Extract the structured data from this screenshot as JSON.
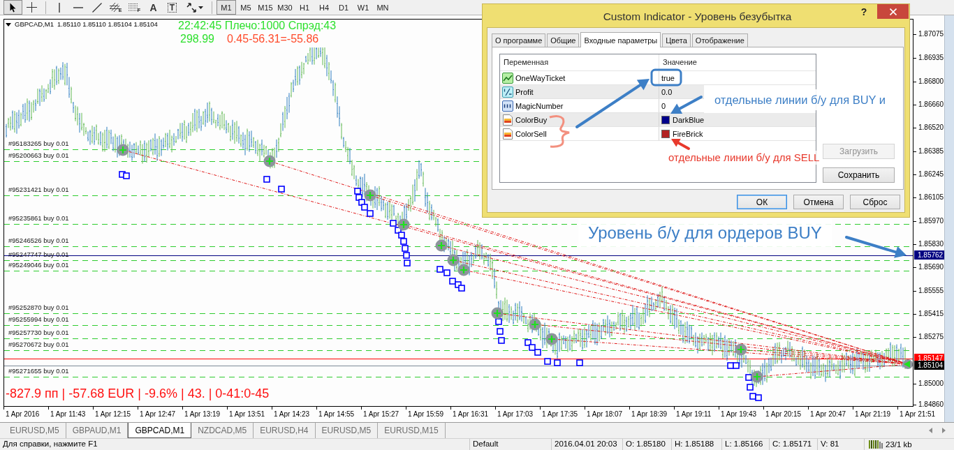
{
  "toolbar": {
    "tools": [
      {
        "kind": "cursor",
        "selected": true
      },
      {
        "kind": "crosshair",
        "selected": false
      },
      {
        "kind": "vertical-line",
        "selected": false
      },
      {
        "kind": "horizontal-line",
        "selected": false
      },
      {
        "kind": "trend-line",
        "selected": false
      },
      {
        "kind": "fibo-channel",
        "letter": "E",
        "selected": false
      },
      {
        "kind": "fibo-lines",
        "letter": "F",
        "selected": false
      },
      {
        "kind": "text",
        "label": "A",
        "selected": false
      },
      {
        "kind": "text-label",
        "label": "T",
        "selected": false
      },
      {
        "kind": "arrows",
        "selected": false
      }
    ],
    "timeframes": [
      {
        "label": "M1",
        "selected": true
      },
      {
        "label": "M5",
        "selected": false
      },
      {
        "label": "M15",
        "selected": false
      },
      {
        "label": "M30",
        "selected": false
      },
      {
        "label": "H1",
        "selected": false
      },
      {
        "label": "H4",
        "selected": false
      },
      {
        "label": "D1",
        "selected": false
      },
      {
        "label": "W1",
        "selected": false
      },
      {
        "label": "MN",
        "selected": false
      }
    ]
  },
  "chart": {
    "symbol": "GBPCAD,M1",
    "quote": "1.85110 1.85110 1.85104 1.85104",
    "status_line": "22:42:45 Плечо:1000 Спрэд:43",
    "balance": "298.99",
    "profit_calc": "0.45-56.31=-55.86",
    "summary": "-827.9 пп | -57.68 EUR | -9.6% | 43. | 0-41:0-45",
    "orders": [
      {
        "label": "#95183265 buy 0.01"
      },
      {
        "label": "#95200663 buy 0.01"
      },
      {
        "label": "#95231421 buy 0.01"
      },
      {
        "label": "#95235861 buy 0.01"
      },
      {
        "label": "#95246526 buy 0.01"
      },
      {
        "label": "#95247747 buy 0.01"
      },
      {
        "label": "#95249046 buy 0.01"
      },
      {
        "label": "#95252870 buy 0.01"
      },
      {
        "label": "#95255994 buy 0.01"
      },
      {
        "label": "#95257730 buy 0.01"
      },
      {
        "label": "#95270672 buy 0.01"
      },
      {
        "label": "#95271655 buy 0.01"
      }
    ],
    "price_ticks": [
      "1.87075",
      "1.86935",
      "1.86800",
      "1.86660",
      "1.86520",
      "1.86385",
      "1.86245",
      "1.86105",
      "1.85970",
      "1.85830",
      "1.85690",
      "1.85555",
      "1.85415",
      "1.85275",
      "1.85000",
      "1.84860"
    ],
    "price_markers": [
      {
        "kind": "breakeven",
        "label": "1.85762",
        "color": "#000080"
      },
      {
        "kind": "ask",
        "label": "1.85147",
        "color": "#ff0000"
      },
      {
        "kind": "bid",
        "label": "1.85104",
        "color": "#000000"
      }
    ],
    "time_ticks": [
      "1 Apr 2016",
      "1 Apr 11:43",
      "1 Apr 12:15",
      "1 Apr 12:47",
      "1 Apr 13:19",
      "1 Apr 13:51",
      "1 Apr 14:23",
      "1 Apr 14:55",
      "1 Apr 15:27",
      "1 Apr 15:59",
      "1 Apr 16:31",
      "1 Apr 17:03",
      "1 Apr 17:35",
      "1 Apr 18:07",
      "1 Apr 18:39",
      "1 Apr 19:11",
      "1 Apr 19:43",
      "1 Apr 20:15",
      "1 Apr 20:47",
      "1 Apr 21:19",
      "1 Apr 21:51"
    ]
  },
  "dialog": {
    "title": "Custom Indicator - Уровень безубытка",
    "help": "?",
    "tabs": [
      {
        "label": "О программе",
        "selected": false
      },
      {
        "label": "Общие",
        "selected": false
      },
      {
        "label": "Входные параметры",
        "selected": true
      },
      {
        "label": "Цвета",
        "selected": false
      },
      {
        "label": "Отображение",
        "selected": false
      }
    ],
    "columns": [
      "Переменная",
      "Значение"
    ],
    "parameters": [
      {
        "kind": "bool",
        "name": "OneWayTicket",
        "value": "true"
      },
      {
        "kind": "double",
        "name": "Profit",
        "value": "0.0"
      },
      {
        "kind": "int",
        "name": "MagicNumber",
        "value": "0"
      },
      {
        "kind": "color",
        "name": "ColorBuy",
        "value": "DarkBlue",
        "color": "#00008b"
      },
      {
        "kind": "color",
        "name": "ColorSell",
        "value": "FireBrick",
        "color": "#b22222"
      }
    ],
    "side_buttons": [
      {
        "label": "Загрузить",
        "disabled": true
      },
      {
        "label": "Сохранить",
        "disabled": false
      }
    ],
    "buttons": [
      {
        "label": "ОК",
        "default": true
      },
      {
        "label": "Отмена",
        "default": false
      },
      {
        "label": "Сброс",
        "default": false
      }
    ]
  },
  "annotations": [
    {
      "text": "отдельные линии б/у для BUY и",
      "color": "#3d7fc6"
    },
    {
      "text": "отдельные линии б/у для SELL",
      "color": "#e8392c"
    },
    {
      "text": "Уровень б/у для ордеров BUY",
      "color": "#3d7fc6"
    }
  ],
  "symbol_tabs": [
    {
      "label": "EURUSD,M5",
      "selected": false
    },
    {
      "label": "GBPAUD,M1",
      "selected": false
    },
    {
      "label": "GBPCAD,M1",
      "selected": true
    },
    {
      "label": "NZDCAD,M5",
      "selected": false
    },
    {
      "label": "EURUSD,H4",
      "selected": false
    },
    {
      "label": "EURUSD,M5",
      "selected": false
    },
    {
      "label": "EURUSD,M15",
      "selected": false
    }
  ],
  "status_bar": [
    {
      "kind": "text",
      "text": "Для справки, нажмите F1"
    },
    {
      "kind": "text",
      "text": "Default"
    },
    {
      "kind": "text",
      "text": "2016.04.01 20:03"
    },
    {
      "kind": "text",
      "text": "O: 1.85180"
    },
    {
      "kind": "text",
      "text": "H: 1.85188"
    },
    {
      "kind": "text",
      "text": "L: 1.85166"
    },
    {
      "kind": "text",
      "text": "C: 1.85171"
    },
    {
      "kind": "text",
      "text": "V: 81"
    },
    {
      "kind": "traffic",
      "text": "23/1 kb"
    }
  ]
}
